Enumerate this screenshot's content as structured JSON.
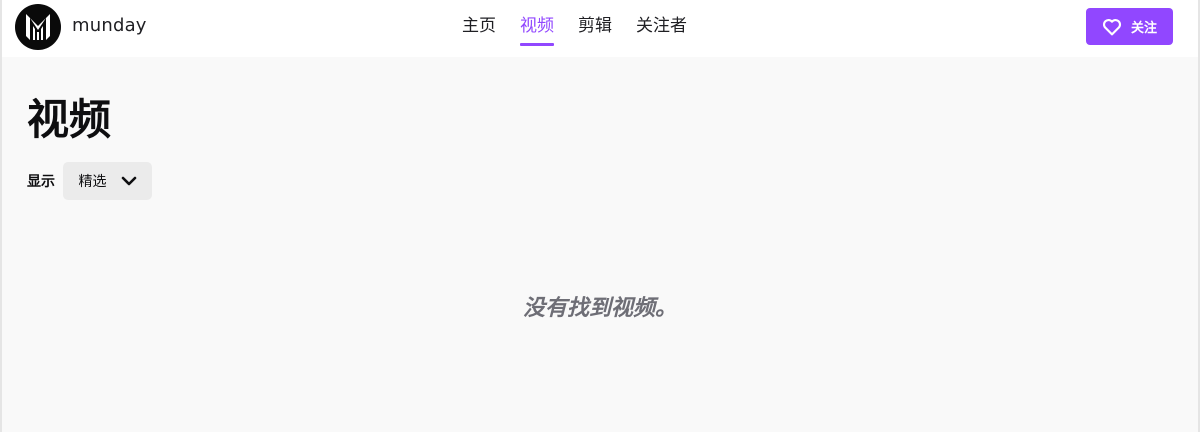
{
  "header": {
    "channel_name": "munday",
    "nav": [
      {
        "label": "主页",
        "active": false
      },
      {
        "label": "视频",
        "active": true
      },
      {
        "label": "剪辑",
        "active": false
      },
      {
        "label": "关注者",
        "active": false
      }
    ],
    "follow_label": "关注"
  },
  "main": {
    "title": "视频",
    "filter_label": "显示",
    "filter_value": "精选",
    "empty_message": "没有找到视频。"
  },
  "colors": {
    "accent": "#9147ff",
    "background": "#f9f9f9",
    "header_bg": "#ffffff"
  },
  "icons": {
    "avatar": "channel-logo-icon",
    "follow": "heart-icon",
    "dropdown": "chevron-down-icon"
  }
}
